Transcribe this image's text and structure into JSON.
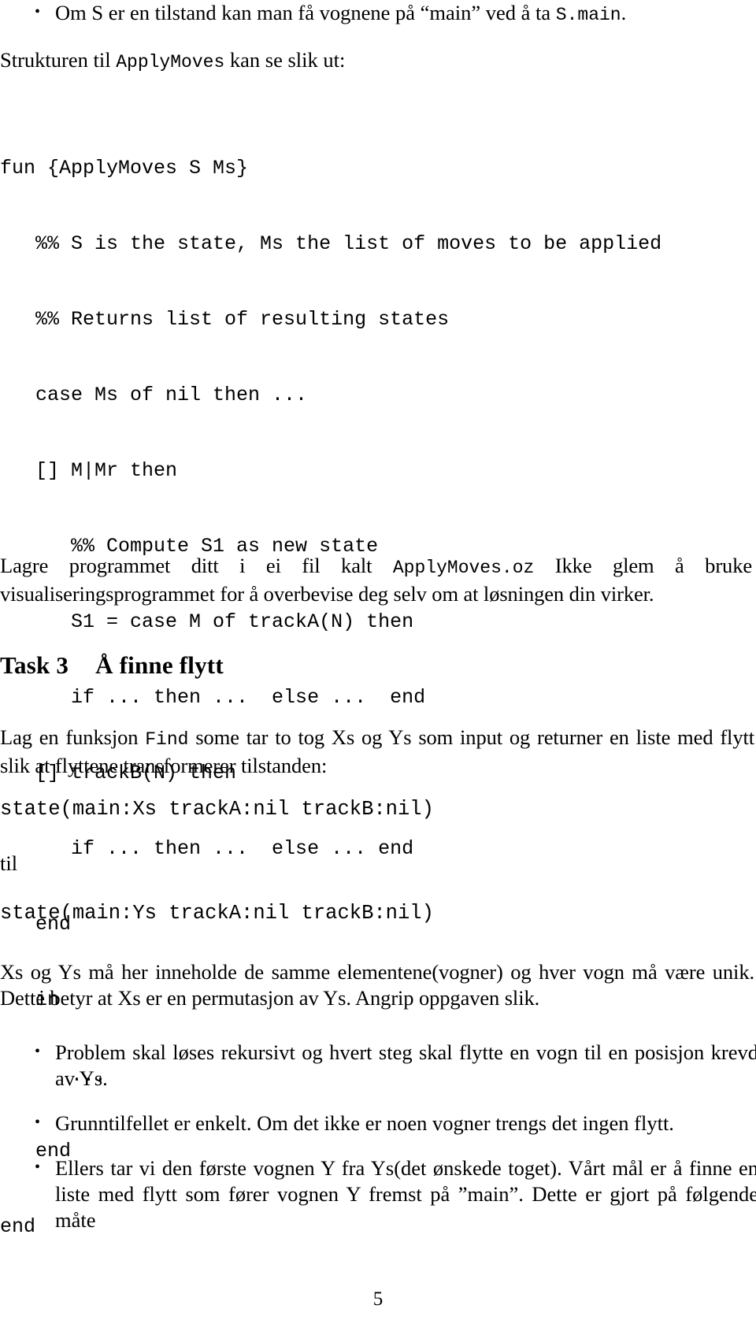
{
  "page": {
    "number": "5",
    "language": "Norwegian"
  },
  "intro_bullet": {
    "text_before_mono": "Om S er en tilstand kan man få vognene på “main” ved å ta ",
    "mono": "S.main",
    "text_after_mono": "."
  },
  "structure_intro": {
    "before_mono": "Strukturen til ",
    "mono": "ApplyMoves",
    "after_mono": " kan se slik ut:"
  },
  "code_block": {
    "lines": [
      "fun {ApplyMoves S Ms}",
      "   %% S is the state, Ms the list of moves to be applied",
      "   %% Returns list of resulting states",
      "   case Ms of nil then ...",
      "   [] M|Mr then",
      "      %% Compute S1 as new state",
      "      S1 = case M of trackA(N) then",
      "      if ... then ...  else ...  end",
      "   [] trackB(N) then",
      "      if ... then ...  else ... end",
      "   end",
      "   in",
      "      ...",
      "   end",
      "end"
    ]
  },
  "save_paragraph": {
    "before_mono": "Lagre programmet ditt i ei fil kalt ",
    "mono": "ApplyMoves.oz",
    "after_mono": " Ikke glem å bruke visualiseringsprogrammet for å overbevise deg selv om at løsningen din virker."
  },
  "task_heading": {
    "number": "Task 3",
    "title": "Å finne flytt"
  },
  "find_paragraph": {
    "before_mono": "Lag en funksjon ",
    "mono": "Find",
    "after_mono": " some tar to tog Xs og Ys som input og returner en liste med flytt slik at flyttene transformerer tilstanden:"
  },
  "state_from": "state(main:Xs trackA:nil trackB:nil)",
  "til_label": "til",
  "state_to": "state(main:Ys trackA:nil trackB:nil)",
  "permutation_paragraph": "Xs og Ys må her inneholde de samme elementene(vogner) og hver vogn må være unik. Dette betyr at Xs er en permutasjon av Ys. Angrip oppgaven slik.",
  "approach_bullets": [
    "Problem skal løses rekursivt og hvert steg skal flytte en vogn til en posisjon krevd av Ys.",
    "Grunntilfellet er enkelt.  Om det ikke er noen vogner trengs det ingen flytt.",
    "Ellers tar vi den første vognen Y fra Ys(det ønskede toget). Vårt mål er å finne en liste med flytt som fører vognen Y fremst på ”main”. Dette er gjort på følgende måte"
  ]
}
